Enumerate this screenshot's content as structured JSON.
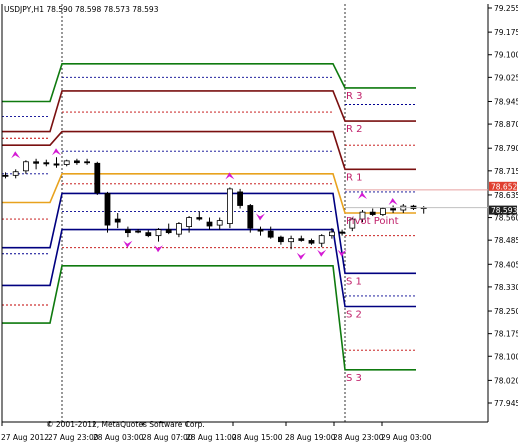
{
  "header": {
    "symbol_line": "USDJPY,H1  78.590 78.598 78.573 78.593"
  },
  "footer": {
    "copyright": "© 2001-2012, MetaQuotes Software Corp."
  },
  "colors": {
    "background": "#ffffff",
    "axis": "#000000",
    "pivot": "#e8a21e",
    "r1": "#7a1010",
    "r2": "#7a1010",
    "r3": "#0f7a0f",
    "s1": "#000080",
    "s2": "#000080",
    "s3": "#0f7a0f",
    "mid_dotted": "#c00000",
    "blue_dotted": "#000090",
    "arrow": "#d41ad4",
    "label": "#c0206a",
    "price_tag_up": "#e04030",
    "price_tag_down": "#202020"
  },
  "chart_data": {
    "type": "candlestick",
    "title": "USDJPY,H1  78.590 78.598 78.573 78.593",
    "y_ticks": [
      "79.255",
      "79.175",
      "79.100",
      "79.025",
      "78.945",
      "78.870",
      "78.790",
      "78.715",
      "78.635",
      "78.560",
      "78.485",
      "78.405",
      "78.330",
      "78.250",
      "78.175",
      "78.100",
      "78.020",
      "77.945"
    ],
    "x_ticks": [
      "27 Aug 2012",
      "27 Aug 23:00",
      "28 Aug 03:00",
      "28 Aug 07:00",
      "28 Aug 11:00",
      "28 Aug 15:00",
      "28 Aug 19:00",
      "28 Aug 23:00",
      "29 Aug 03:00"
    ],
    "current_price_tags": [
      "78.652",
      "78.593"
    ],
    "levels": {
      "segment1": {
        "R3": 78.945,
        "R2": 78.845,
        "R1": 78.8,
        "P": 78.61,
        "S1": 78.46,
        "S2": 78.335,
        "S3": 78.21,
        "m_r3r2": 78.895,
        "m_r2r1": 78.823,
        "m_r1p": 78.705,
        "m_ps1": 78.555,
        "m_s1s2": 78.44,
        "m_s2s3": 78.27
      },
      "segment2": {
        "R3": 79.07,
        "R2": 78.98,
        "R1": 78.845,
        "P": 78.705,
        "S1": 78.64,
        "S2": 78.52,
        "S3": 78.4,
        "m_r3r2": 79.025,
        "m_r2r1": 78.91,
        "m_r1p": 78.78,
        "m_ps1": 78.672,
        "m_s1s2": 78.58,
        "m_s2s3": 78.46
      },
      "segment3": {
        "R3": 78.99,
        "R2": 78.88,
        "R1": 78.72,
        "P": 78.575,
        "S1": 78.375,
        "S2": 78.265,
        "S3": 78.055,
        "m_r3r2": 78.935,
        "m_r2r1": 78.8,
        "m_r1p": 78.645,
        "m_ps1": 78.5,
        "m_s1s2": 78.3,
        "m_s2s3": 78.12
      }
    },
    "level_labels": [
      "R 3",
      "R 2",
      "R 1",
      "Pivot Point",
      "S 1",
      "S 2",
      "S 3"
    ],
    "candles": [
      {
        "o": 78.7,
        "h": 78.71,
        "l": 78.69,
        "c": 78.698
      },
      {
        "o": 78.7,
        "h": 78.72,
        "l": 78.69,
        "c": 78.712
      },
      {
        "o": 78.715,
        "h": 78.75,
        "l": 78.705,
        "c": 78.745
      },
      {
        "o": 78.745,
        "h": 78.755,
        "l": 78.72,
        "c": 78.74
      },
      {
        "o": 78.742,
        "h": 78.752,
        "l": 78.73,
        "c": 78.738
      },
      {
        "o": 78.738,
        "h": 78.76,
        "l": 78.725,
        "c": 78.734
      },
      {
        "o": 78.736,
        "h": 78.752,
        "l": 78.73,
        "c": 78.748
      },
      {
        "o": 78.748,
        "h": 78.755,
        "l": 78.735,
        "c": 78.742
      },
      {
        "o": 78.745,
        "h": 78.755,
        "l": 78.735,
        "c": 78.742
      },
      {
        "o": 78.74,
        "h": 78.745,
        "l": 78.635,
        "c": 78.642
      },
      {
        "o": 78.64,
        "h": 78.645,
        "l": 78.51,
        "c": 78.535
      },
      {
        "o": 78.555,
        "h": 78.575,
        "l": 78.525,
        "c": 78.545
      },
      {
        "o": 78.52,
        "h": 78.53,
        "l": 78.495,
        "c": 78.51
      },
      {
        "o": 78.515,
        "h": 78.522,
        "l": 78.508,
        "c": 78.514
      },
      {
        "o": 78.51,
        "h": 78.518,
        "l": 78.495,
        "c": 78.5
      },
      {
        "o": 78.5,
        "h": 78.525,
        "l": 78.48,
        "c": 78.52
      },
      {
        "o": 78.52,
        "h": 78.54,
        "l": 78.505,
        "c": 78.51
      },
      {
        "o": 78.505,
        "h": 78.545,
        "l": 78.495,
        "c": 78.54
      },
      {
        "o": 78.53,
        "h": 78.565,
        "l": 78.51,
        "c": 78.56
      },
      {
        "o": 78.56,
        "h": 78.58,
        "l": 78.55,
        "c": 78.555
      },
      {
        "o": 78.545,
        "h": 78.56,
        "l": 78.52,
        "c": 78.532
      },
      {
        "o": 78.535,
        "h": 78.56,
        "l": 78.52,
        "c": 78.55
      },
      {
        "o": 78.54,
        "h": 78.66,
        "l": 78.525,
        "c": 78.655
      },
      {
        "o": 78.645,
        "h": 78.655,
        "l": 78.59,
        "c": 78.6
      },
      {
        "o": 78.6,
        "h": 78.605,
        "l": 78.51,
        "c": 78.525
      },
      {
        "o": 78.52,
        "h": 78.53,
        "l": 78.5,
        "c": 78.515
      },
      {
        "o": 78.515,
        "h": 78.53,
        "l": 78.49,
        "c": 78.495
      },
      {
        "o": 78.495,
        "h": 78.5,
        "l": 78.47,
        "c": 78.48
      },
      {
        "o": 78.48,
        "h": 78.5,
        "l": 78.455,
        "c": 78.49
      },
      {
        "o": 78.49,
        "h": 78.5,
        "l": 78.48,
        "c": 78.484
      },
      {
        "o": 78.484,
        "h": 78.49,
        "l": 78.47,
        "c": 78.475
      },
      {
        "o": 78.475,
        "h": 78.505,
        "l": 78.462,
        "c": 78.5
      },
      {
        "o": 78.5,
        "h": 78.525,
        "l": 78.49,
        "c": 78.512
      },
      {
        "o": 78.512,
        "h": 78.52,
        "l": 78.5,
        "c": 78.508
      },
      {
        "o": 78.525,
        "h": 78.56,
        "l": 78.515,
        "c": 78.555
      },
      {
        "o": 78.555,
        "h": 78.585,
        "l": 78.545,
        "c": 78.578
      },
      {
        "o": 78.578,
        "h": 78.59,
        "l": 78.565,
        "c": 78.57
      },
      {
        "o": 78.57,
        "h": 78.595,
        "l": 78.565,
        "c": 78.59
      },
      {
        "o": 78.59,
        "h": 78.6,
        "l": 78.575,
        "c": 78.585
      },
      {
        "o": 78.585,
        "h": 78.605,
        "l": 78.575,
        "c": 78.598
      },
      {
        "o": 78.598,
        "h": 78.602,
        "l": 78.585,
        "c": 78.59
      },
      {
        "o": 78.59,
        "h": 78.598,
        "l": 78.573,
        "c": 78.593
      }
    ],
    "arrows_up": [
      {
        "candle": 1,
        "price": 78.77
      },
      {
        "candle": 5,
        "price": 78.78
      },
      {
        "candle": 22,
        "price": 78.7
      },
      {
        "candle": 35,
        "price": 78.635
      },
      {
        "candle": 38,
        "price": 78.615
      }
    ],
    "arrows_down": [
      {
        "candle": 12,
        "price": 78.47
      },
      {
        "candle": 15,
        "price": 78.455
      },
      {
        "candle": 25,
        "price": 78.56
      },
      {
        "candle": 29,
        "price": 78.43
      },
      {
        "candle": 31,
        "price": 78.44
      },
      {
        "candle": 33,
        "price": 78.44
      }
    ]
  }
}
